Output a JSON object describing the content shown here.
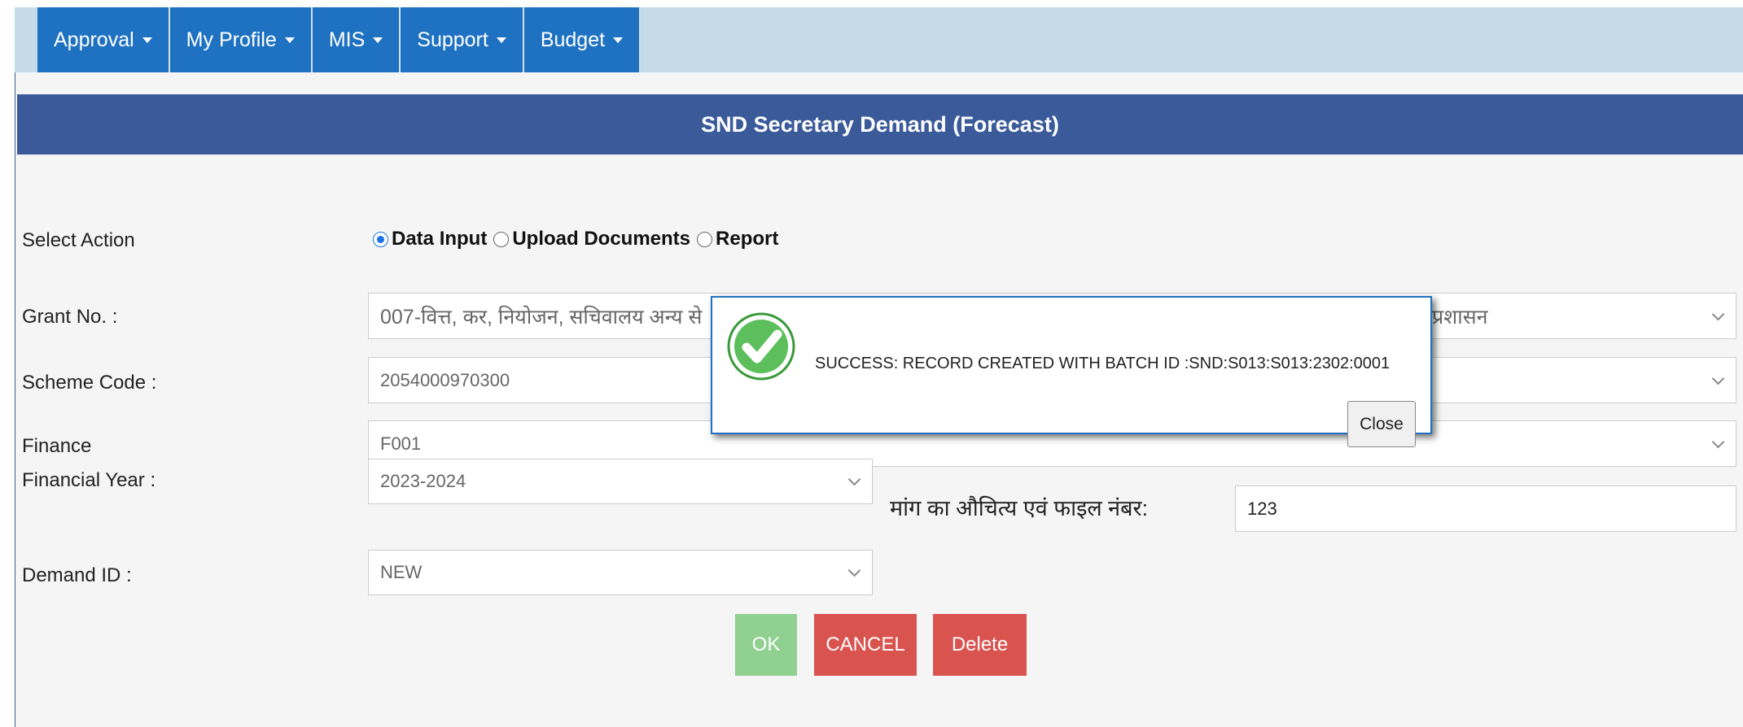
{
  "nav": {
    "items": [
      "Approval",
      "My Profile",
      "MIS",
      "Support",
      "Budget"
    ]
  },
  "page": {
    "title": "SND Secretary Demand (Forecast)"
  },
  "form": {
    "select_action_label": "Select Action",
    "radio_options": [
      "Data Input",
      "Upload Documents",
      "Report"
    ],
    "radio_selected": "Data Input",
    "grant_label": "Grant No. :",
    "grant_value_left": "007-वित्त, कर, नियोजन, सचिवालय अन्य से",
    "grant_value_right": "प्रशासन",
    "scheme_label": "Scheme Code :",
    "scheme_value": "2054000970300",
    "finance_label": "Finance",
    "finance_value": "F001",
    "fy_label": "Financial Year :",
    "fy_value": "2023-2024",
    "justification_label": "मांग का औचित्य एवं फाइल नंबर:",
    "justification_value": "123",
    "demand_label": "Demand ID :",
    "demand_value": "NEW"
  },
  "buttons": {
    "ok": "OK",
    "cancel": "CANCEL",
    "delete": "Delete"
  },
  "modal": {
    "message": "SUCCESS: RECORD CREATED WITH BATCH ID :SND:S013:S013:2302:0001",
    "close": "Close",
    "icon": "success-check-icon",
    "icon_color": "#4caf50"
  },
  "colors": {
    "nav_bg": "#1f72c2",
    "title_bg": "#3a5a9a",
    "ok": "#90d090",
    "danger": "#d9534f"
  }
}
